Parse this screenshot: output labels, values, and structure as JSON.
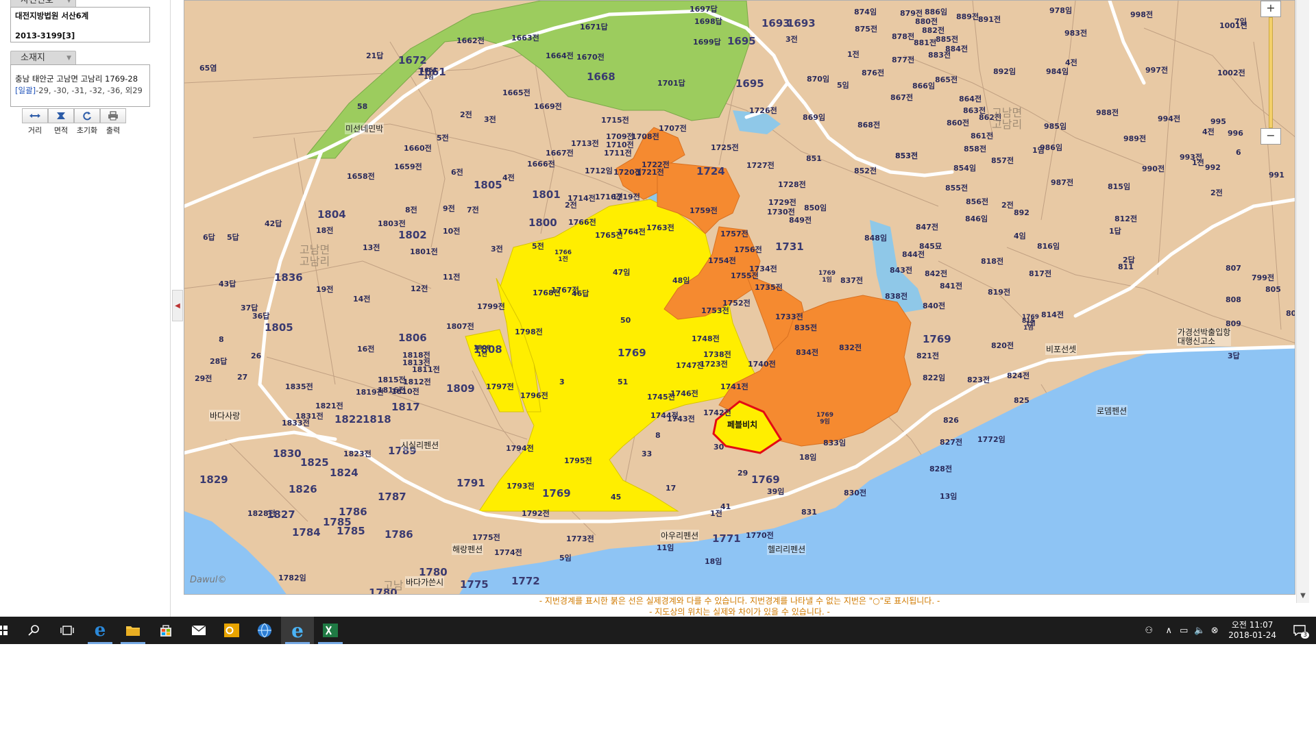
{
  "panel": {
    "case_tab": "사건번호",
    "court": "대전지방법원 서산6계",
    "case_no": "2013-3199[3]",
    "location_tab": "소재지",
    "address": "충남 태안군 고남면 고남리 1769-28",
    "bulk_label": "[일괄]",
    "bulk_rest": "-29, -30, -31, -32, -36, 외29",
    "tools": [
      "거리",
      "면적",
      "초기화",
      "출력"
    ]
  },
  "map": {
    "watermark_1": "고남면\n고남리",
    "watermark_2": "고남면\n고남리",
    "watermark_3": "고남",
    "target_label": "페블비치",
    "brand": "Dawul©",
    "places": [
      "미선네민박",
      "바다사랑",
      "시실리펜션",
      "해랑펜션",
      "바다가쓴시",
      "아우리펜션",
      "헬리리펜션",
      "로뎀펜션",
      "비포선셋",
      "가경선박출입항\n대행신고소"
    ],
    "parcels": [
      [
        "1671답",
        845,
        30
      ],
      [
        "1697답",
        1005,
        4
      ],
      [
        "1698답",
        1012,
        22
      ],
      [
        "1699답",
        1010,
        52
      ],
      [
        "1695",
        1060,
        50
      ],
      [
        "1693",
        1110,
        24
      ],
      [
        "3전",
        1145,
        48
      ],
      [
        "1662전",
        665,
        50
      ],
      [
        "1663전",
        745,
        46
      ],
      [
        "1664전",
        795,
        72
      ],
      [
        "1670전",
        840,
        74
      ],
      [
        "1668",
        855,
        102
      ],
      [
        "1701답",
        958,
        112
      ],
      [
        "1695",
        1072,
        112
      ],
      [
        "1672",
        580,
        78
      ],
      [
        "1661",
        608,
        95
      ],
      [
        "1661\n1임",
        612,
        97
      ],
      [
        "21답",
        533,
        72
      ],
      [
        "65염",
        290,
        90
      ],
      [
        "58",
        520,
        148
      ],
      [
        "1665전",
        732,
        126
      ],
      [
        "1669전",
        778,
        146
      ],
      [
        "2전",
        670,
        158
      ],
      [
        "3전",
        705,
        165
      ],
      [
        "1715전",
        876,
        166
      ],
      [
        "1707전",
        960,
        178
      ],
      [
        "1709전",
        883,
        190
      ],
      [
        "1708전",
        920,
        190
      ],
      [
        "1710전",
        883,
        202
      ],
      [
        "1711전",
        880,
        214
      ],
      [
        "1725전",
        1036,
        206
      ],
      [
        "1726전",
        1092,
        152
      ],
      [
        "869임",
        1170,
        162
      ],
      [
        "868전",
        1250,
        173
      ],
      [
        "853전",
        1305,
        218
      ],
      [
        "1727전",
        1088,
        232
      ],
      [
        "1724",
        1015,
        240
      ],
      [
        "1722전",
        935,
        231
      ],
      [
        "1720전",
        894,
        242
      ],
      [
        "1721전",
        927,
        242
      ],
      [
        "1712임",
        852,
        240
      ],
      [
        "1713전",
        832,
        200
      ],
      [
        "1667전",
        795,
        214
      ],
      [
        "1666전",
        768,
        230
      ],
      [
        "1660전",
        588,
        207
      ],
      [
        "5전",
        636,
        192
      ],
      [
        "1659전",
        574,
        234
      ],
      [
        "6전",
        657,
        242
      ],
      [
        "4전",
        732,
        250
      ],
      [
        "1658전",
        505,
        248
      ],
      [
        "1805",
        690,
        260
      ],
      [
        "1728전",
        1134,
        260
      ],
      [
        "851",
        1175,
        224
      ],
      [
        "852전",
        1245,
        240
      ],
      [
        "853전",
        1305,
        218
      ],
      [
        "1729전",
        1120,
        286
      ],
      [
        "1730전",
        1118,
        300
      ],
      [
        "850임",
        1172,
        294
      ],
      [
        "849전",
        1150,
        312
      ],
      [
        "848임",
        1260,
        338
      ],
      [
        "847전",
        1335,
        322
      ],
      [
        "845묘",
        1340,
        350
      ],
      [
        "844전",
        1315,
        362
      ],
      [
        "1714전",
        827,
        280
      ],
      [
        "1716전",
        867,
        278
      ],
      [
        "1719전",
        892,
        278
      ],
      [
        "1759전",
        1005,
        298
      ],
      [
        "1801",
        775,
        274
      ],
      [
        "2전",
        823,
        290
      ],
      [
        "8전",
        590,
        297
      ],
      [
        "9전",
        645,
        295
      ],
      [
        "7전",
        680,
        297
      ],
      [
        "1804",
        462,
        303
      ],
      [
        "1803전",
        550,
        317
      ],
      [
        "42답",
        385,
        317
      ],
      [
        "1766전",
        828,
        315
      ],
      [
        "1765전",
        867,
        334
      ],
      [
        "1764전",
        900,
        329
      ],
      [
        "1763전",
        942,
        323
      ],
      [
        "1757전",
        1050,
        332
      ],
      [
        "1756전",
        1070,
        355
      ],
      [
        "1731",
        1130,
        350
      ],
      [
        "1734전",
        1092,
        383
      ],
      [
        "1754전",
        1032,
        371
      ],
      [
        "1755전",
        1065,
        393
      ],
      [
        "1800",
        770,
        315
      ],
      [
        "1802",
        580,
        333
      ],
      [
        "10전",
        645,
        328
      ],
      [
        "1801전",
        597,
        358
      ],
      [
        "13전",
        528,
        352
      ],
      [
        "5전",
        775,
        350
      ],
      [
        "1766\n1전",
        808,
        363
      ],
      [
        "3전",
        715,
        354
      ],
      [
        "18전",
        460,
        327
      ],
      [
        "5답",
        330,
        337
      ],
      [
        "6답",
        295,
        337
      ],
      [
        "43답",
        318,
        405
      ],
      [
        "1836",
        399,
        395
      ],
      [
        "11전",
        645,
        395
      ],
      [
        "12전",
        598,
        412
      ],
      [
        "19전",
        460,
        413
      ],
      [
        "1735전",
        1100,
        410
      ],
      [
        "1752전",
        1053,
        433
      ],
      [
        "1753전",
        1022,
        444
      ],
      [
        "1733전",
        1130,
        453
      ],
      [
        "835전",
        1158,
        469
      ],
      [
        "834전",
        1160,
        505
      ],
      [
        "832전",
        1223,
        498
      ],
      [
        "1768전",
        776,
        418
      ],
      [
        "1767전",
        803,
        414
      ],
      [
        "46답",
        833,
        419
      ],
      [
        "47임",
        893,
        388
      ],
      [
        "48임",
        980,
        400
      ],
      [
        "50",
        904,
        460
      ],
      [
        "1769",
        900,
        505
      ],
      [
        "51",
        900,
        550
      ],
      [
        "3",
        815,
        550
      ],
      [
        "1799전",
        695,
        438
      ],
      [
        "1798전",
        750,
        475
      ],
      [
        "1807전",
        650,
        467
      ],
      [
        "1806",
        580,
        483
      ],
      [
        "1808",
        690,
        500
      ],
      [
        "1808\n1전",
        690,
        502
      ],
      [
        "1748전",
        1008,
        485
      ],
      [
        "1738전",
        1025,
        508
      ],
      [
        "1723전",
        1020,
        522
      ],
      [
        "1740전",
        1090,
        522
      ],
      [
        "1747전",
        985,
        524
      ],
      [
        "16전",
        520,
        500
      ],
      [
        "14전",
        514,
        427
      ],
      [
        "37답",
        350,
        440
      ],
      [
        "36답",
        367,
        452
      ],
      [
        "1805",
        385,
        468
      ],
      [
        "8",
        318,
        488
      ],
      [
        "26",
        365,
        512
      ],
      [
        "28답",
        305,
        518
      ],
      [
        "27",
        345,
        543
      ],
      [
        "29전",
        283,
        543
      ],
      [
        "1835전",
        415,
        555
      ],
      [
        "1819전",
        518,
        563
      ],
      [
        "1818전",
        586,
        509
      ],
      [
        "1813전",
        586,
        520
      ],
      [
        "1811전",
        600,
        530
      ],
      [
        "1812전",
        587,
        548
      ],
      [
        "1815전",
        550,
        545
      ],
      [
        "1816전",
        550,
        560
      ],
      [
        "1810전",
        570,
        562
      ],
      [
        "1809",
        650,
        557
      ],
      [
        "1797전",
        708,
        555
      ],
      [
        "1796전",
        758,
        568
      ],
      [
        "1741전",
        1050,
        555
      ],
      [
        "1746전",
        977,
        565
      ],
      [
        "1745전",
        943,
        570
      ],
      [
        "1744전",
        948,
        597
      ],
      [
        "1743전",
        972,
        602
      ],
      [
        "1742전",
        1025,
        593
      ],
      [
        "1818",
        528,
        602
      ],
      [
        "1817",
        570,
        584
      ],
      [
        "1822",
        487,
        602
      ],
      [
        "1821전",
        459,
        583
      ],
      [
        "1833전",
        410,
        608
      ],
      [
        "1831전",
        430,
        598
      ],
      [
        "1830",
        397,
        652
      ],
      [
        "1825",
        437,
        665
      ],
      [
        "1823전",
        500,
        653
      ],
      [
        "1824",
        480,
        680
      ],
      [
        "1789",
        565,
        648
      ],
      [
        "1794전",
        737,
        645
      ],
      [
        "1795전",
        822,
        663
      ],
      [
        "1791",
        665,
        695
      ],
      [
        "1793전",
        738,
        700
      ],
      [
        "1769",
        790,
        710
      ],
      [
        "1769",
        1095,
        690
      ],
      [
        "8",
        955,
        628
      ],
      [
        "30",
        1040,
        645
      ],
      [
        "33",
        935,
        655
      ],
      [
        "29",
        1075,
        683
      ],
      [
        "17",
        970,
        705
      ],
      [
        "45",
        890,
        718
      ],
      [
        "41",
        1050,
        732
      ],
      [
        "39임",
        1118,
        708
      ],
      [
        "18임",
        1165,
        658
      ],
      [
        "1792전",
        760,
        740
      ],
      [
        "1787",
        550,
        715
      ],
      [
        "1786",
        560,
        770
      ],
      [
        "1786",
        493,
        737
      ],
      [
        "1784",
        425,
        767
      ],
      [
        "1785",
        470,
        752
      ],
      [
        "1785",
        490,
        765
      ],
      [
        "1829",
        290,
        690
      ],
      [
        "1826",
        420,
        704
      ],
      [
        "1828전",
        360,
        740
      ],
      [
        "1827",
        388,
        741
      ],
      [
        "1782임",
        405,
        834
      ],
      [
        "1780",
        537,
        855
      ],
      [
        "1780",
        610,
        825
      ],
      [
        "1775",
        670,
        843
      ],
      [
        "1775전",
        688,
        775
      ],
      [
        "1774전",
        720,
        797
      ],
      [
        "1773전",
        825,
        777
      ],
      [
        "1772",
        745,
        838
      ],
      [
        "1771",
        1038,
        776
      ],
      [
        "1770전",
        1087,
        772
      ],
      [
        "1전",
        1035,
        740
      ],
      [
        "11임",
        957,
        790
      ],
      [
        "18임",
        1027,
        810
      ],
      [
        "5임",
        815,
        805
      ],
      [
        "831",
        1168,
        740
      ],
      [
        "830전",
        1230,
        710
      ],
      [
        "828전",
        1355,
        675
      ],
      [
        "827전",
        1370,
        636
      ],
      [
        "826",
        1375,
        606
      ],
      [
        "1772임",
        1425,
        632
      ],
      [
        "13임",
        1370,
        715
      ],
      [
        "833임",
        1200,
        637
      ],
      [
        "1769\n9임",
        1190,
        600
      ],
      [
        "822임",
        1345,
        542
      ],
      [
        "823전",
        1410,
        545
      ],
      [
        "824전",
        1468,
        539
      ],
      [
        "825",
        1478,
        577
      ],
      [
        "821전",
        1336,
        510
      ],
      [
        "1769",
        1345,
        485
      ],
      [
        "840전",
        1345,
        437
      ],
      [
        "838전",
        1290,
        423
      ],
      [
        "837전",
        1225,
        400
      ],
      [
        "1769\n1임",
        1193,
        393
      ],
      [
        "843전",
        1297,
        385
      ],
      [
        "842전",
        1348,
        390
      ],
      [
        "841전",
        1370,
        408
      ],
      [
        "818전",
        1430,
        372
      ],
      [
        "819전",
        1440,
        417
      ],
      [
        "820전",
        1445,
        495
      ],
      [
        "1769\n1임",
        1490,
        457
      ],
      [
        "815\n1임",
        1490,
        463
      ],
      [
        "814전",
        1518,
        450
      ],
      [
        "816임",
        1512,
        350
      ],
      [
        "817전",
        1500,
        390
      ],
      [
        "4임",
        1478,
        335
      ],
      [
        "2전",
        1460,
        290
      ],
      [
        "892",
        1478,
        303
      ],
      [
        "812전",
        1625,
        310
      ],
      [
        "811",
        1630,
        382
      ],
      [
        "2답",
        1637,
        370
      ],
      [
        "1답",
        1617,
        328
      ],
      [
        "807",
        1787,
        384
      ],
      [
        "799전",
        1825,
        396
      ],
      [
        "805",
        1845,
        415
      ],
      [
        "808",
        1787,
        430
      ],
      [
        "809",
        1787,
        465
      ],
      [
        "804",
        1875,
        450
      ],
      [
        "3답",
        1790,
        510
      ],
      [
        "815임",
        1615,
        263
      ],
      [
        "990전",
        1665,
        237
      ],
      [
        "992",
        1757,
        237
      ],
      [
        "991",
        1850,
        248
      ],
      [
        "993전",
        1720,
        220
      ],
      [
        "994전",
        1688,
        164
      ],
      [
        "995",
        1765,
        170
      ],
      [
        "996",
        1790,
        187
      ],
      [
        "997전",
        1670,
        93
      ],
      [
        "1002전",
        1775,
        97
      ],
      [
        "1001전",
        1778,
        28
      ],
      [
        "998전",
        1648,
        12
      ],
      [
        "989전",
        1638,
        193
      ],
      [
        "988전",
        1598,
        155
      ],
      [
        "1693",
        1147,
        24
      ],
      [
        "874임",
        1245,
        8
      ],
      [
        "875전",
        1246,
        33
      ],
      [
        "876전",
        1256,
        97
      ],
      [
        "877전",
        1300,
        78
      ],
      [
        "878전",
        1300,
        44
      ],
      [
        "879전",
        1312,
        10
      ],
      [
        "886임",
        1348,
        8
      ],
      [
        "880전",
        1334,
        22
      ],
      [
        "881전",
        1332,
        53
      ],
      [
        "882전",
        1344,
        35
      ],
      [
        "883전",
        1353,
        71
      ],
      [
        "885전",
        1364,
        48
      ],
      [
        "884전",
        1378,
        62
      ],
      [
        "889전",
        1394,
        15
      ],
      [
        "891전",
        1426,
        19
      ],
      [
        "978임",
        1530,
        6
      ],
      [
        "983전",
        1552,
        39
      ],
      [
        "892임",
        1448,
        95
      ],
      [
        "984임",
        1525,
        95
      ],
      [
        "866임",
        1330,
        116
      ],
      [
        "865전",
        1363,
        107
      ],
      [
        "867전",
        1298,
        133
      ],
      [
        "864전",
        1398,
        135
      ],
      [
        "863전",
        1404,
        152
      ],
      [
        "862전",
        1427,
        162
      ],
      [
        "861전",
        1415,
        189
      ],
      [
        "860전",
        1380,
        170
      ],
      [
        "857전",
        1445,
        225
      ],
      [
        "858전",
        1405,
        208
      ],
      [
        "854임",
        1390,
        236
      ],
      [
        "855전",
        1378,
        265
      ],
      [
        "856전",
        1408,
        285
      ],
      [
        "846임",
        1407,
        310
      ],
      [
        "870임",
        1176,
        106
      ],
      [
        "1전",
        1235,
        70
      ],
      [
        "5임",
        1220,
        115
      ],
      [
        "1임",
        1505,
        210
      ],
      [
        "986임",
        1516,
        206
      ],
      [
        "985임",
        1522,
        175
      ],
      [
        "987전",
        1532,
        257
      ],
      [
        "4전",
        1553,
        82
      ],
      [
        "7임",
        1800,
        22
      ],
      [
        "4전",
        1753,
        183
      ],
      [
        "6",
        1802,
        215
      ],
      [
        "2전",
        1765,
        272
      ],
      [
        "1전",
        1738,
        228
      ]
    ]
  },
  "notice": {
    "line1": "- 지번경계를 표시한 붉은 선은 실제경계와 다를 수 있습니다. 지번경계를 나타낼 수 없는 지번은 \"○\"로 표시됩니다. -",
    "line2": "- 지도상의 위치는 실제와 차이가 있을 수 있습니다. -"
  },
  "taskbar": {
    "time": "오전 11:07",
    "date": "2018-01-24",
    "notif_count": "3"
  }
}
